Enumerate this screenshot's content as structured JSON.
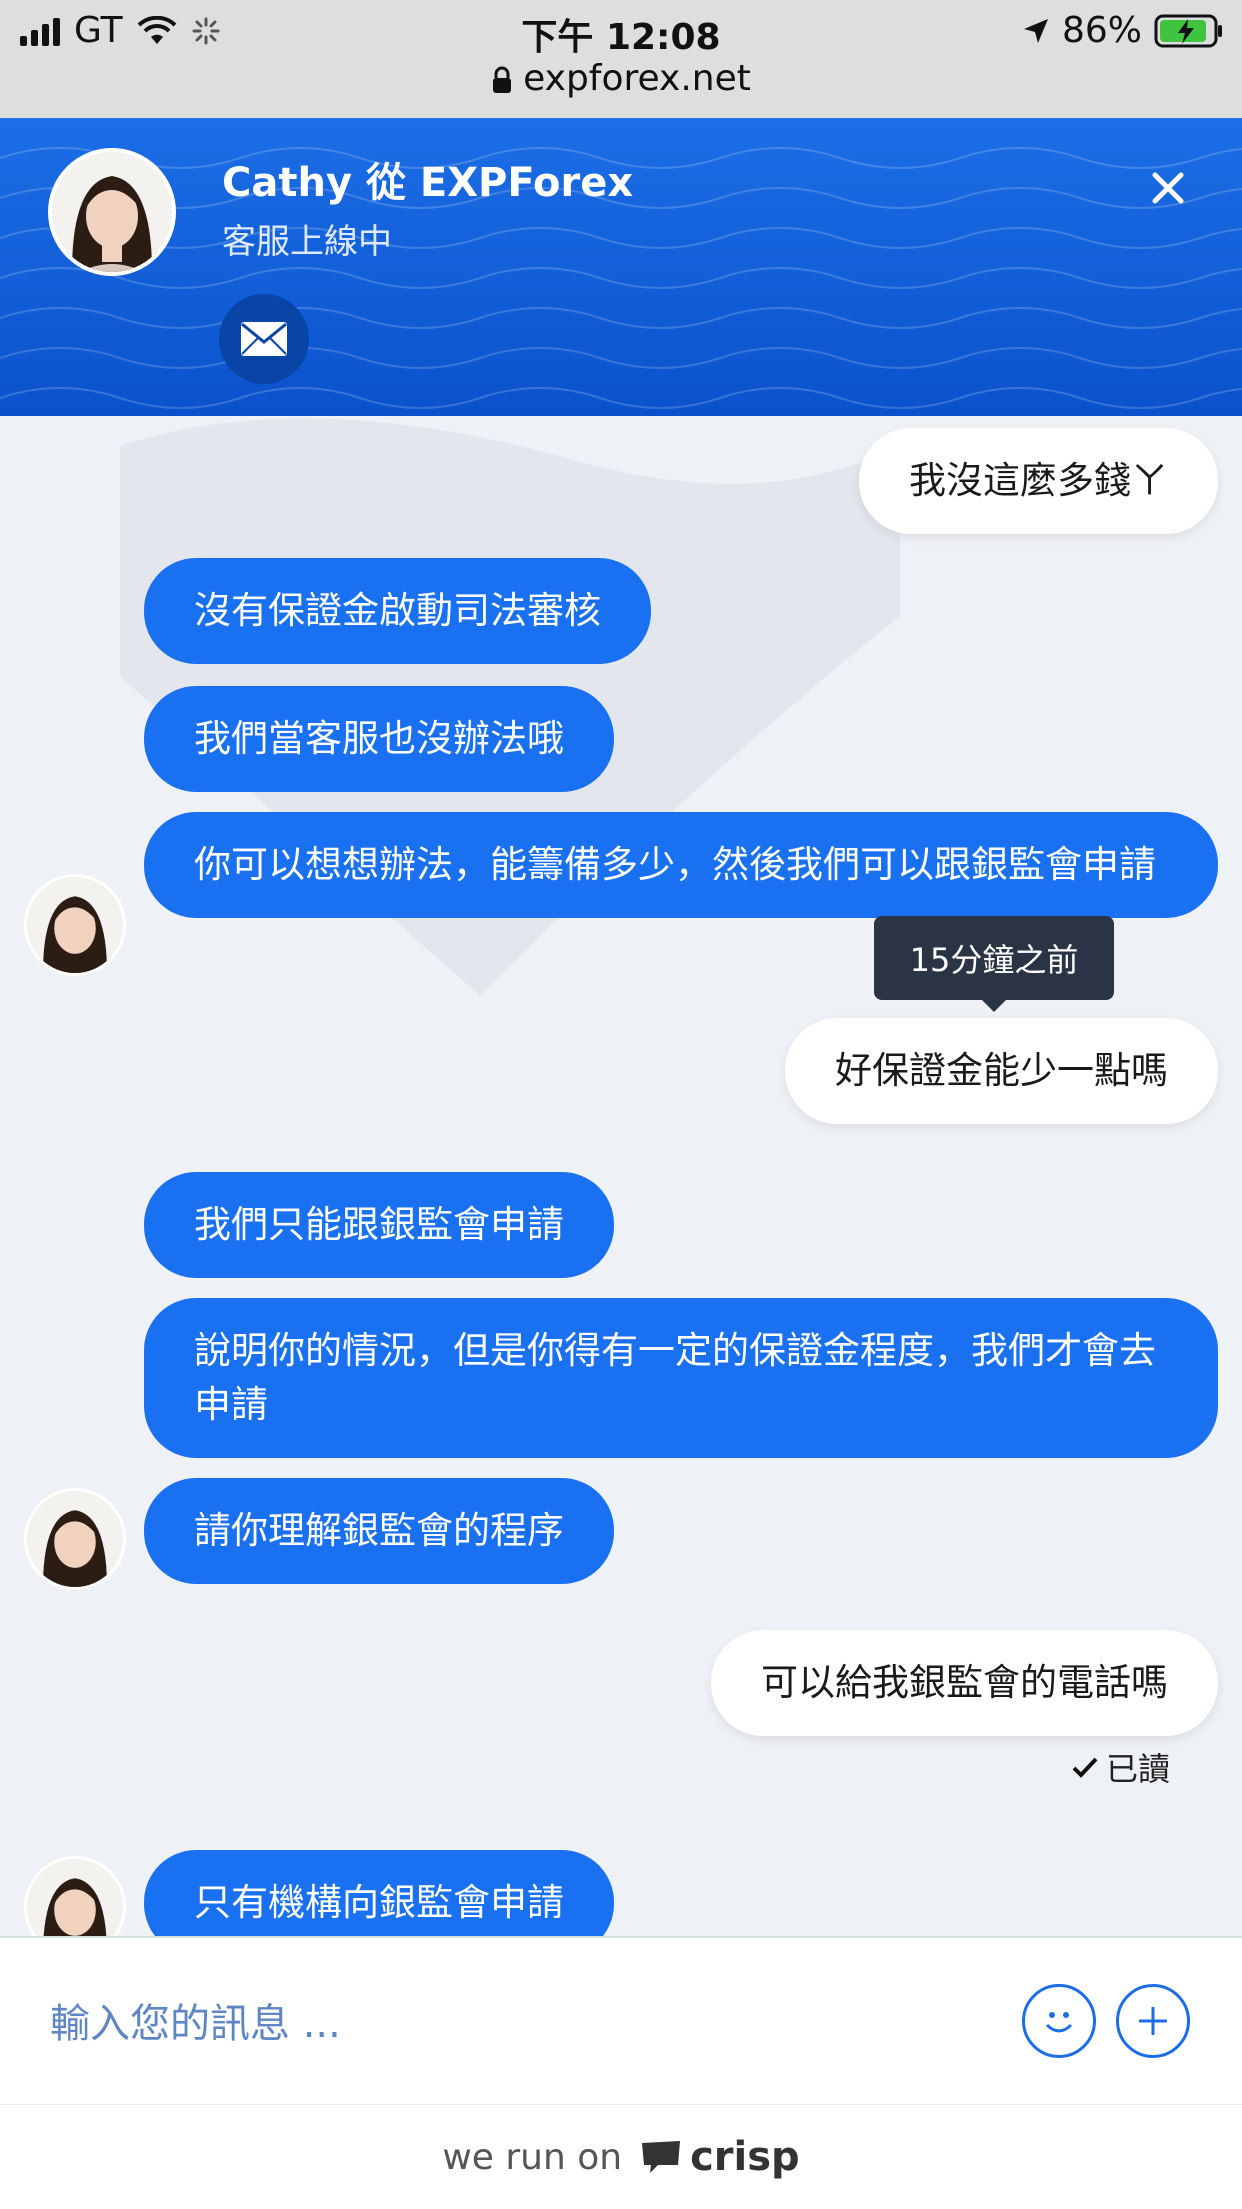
{
  "status_bar": {
    "carrier": "GT",
    "time": "下午 12:08",
    "url": "expforex.net",
    "battery": "86%"
  },
  "header": {
    "title": "Cathy 從 EXPForex",
    "subtitle": "客服上線中",
    "colors": {
      "primary": "#1970f0",
      "dark": "#0845a6"
    }
  },
  "messages": [
    {
      "from": "me",
      "text": "我沒這麼多錢ㄚ"
    },
    {
      "from": "operator",
      "text": "沒有保證金啟動司法審核"
    },
    {
      "from": "operator",
      "text": "我們當客服也沒辦法哦"
    },
    {
      "from": "operator",
      "text": "你可以想想辦法，能籌備多少，然後我們可以跟銀監會申請"
    },
    {
      "from": "me",
      "text": "好保證金能少一點嗎"
    },
    {
      "from": "operator",
      "text": "我們只能跟銀監會申請"
    },
    {
      "from": "operator",
      "text": "說明你的情況，但是你得有一定的保證金程度，我們才會去申請"
    },
    {
      "from": "operator",
      "text": "請你理解銀監會的程序"
    },
    {
      "from": "me",
      "text": "可以給我銀監會的電話嗎"
    },
    {
      "from": "operator",
      "text": "只有機構向銀監會申請"
    }
  ],
  "tooltip": "15分鐘之前",
  "read_receipt": "已讀",
  "composer": {
    "placeholder": "輸入您的訊息 ..."
  },
  "footer": {
    "text": "we run on",
    "brand": "crisp"
  }
}
